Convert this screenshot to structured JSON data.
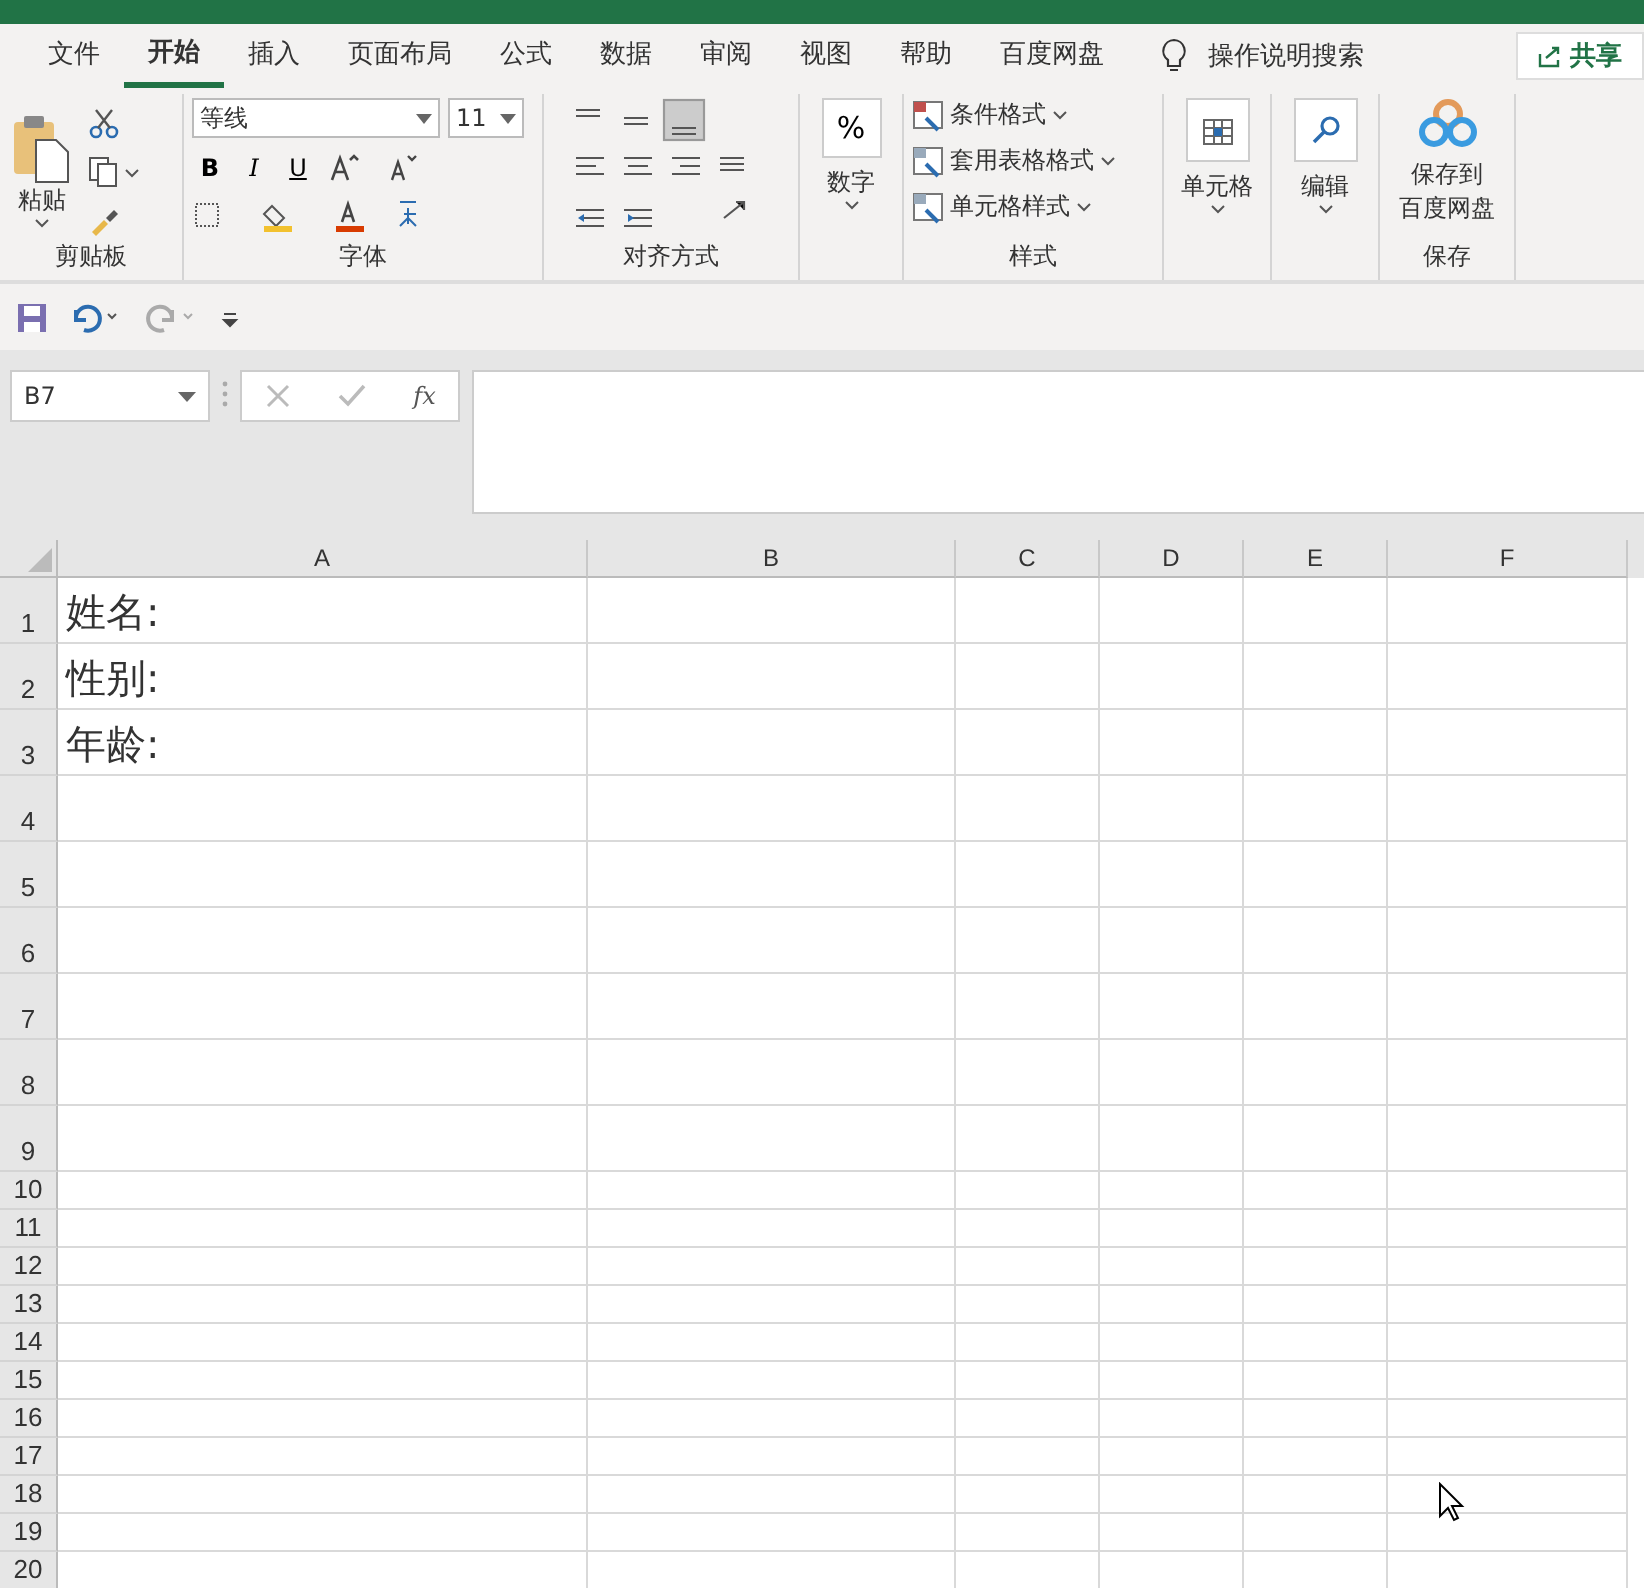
{
  "tabs": [
    {
      "label": "文件",
      "selected": false
    },
    {
      "label": "开始",
      "selected": true
    },
    {
      "label": "插入",
      "selected": false
    },
    {
      "label": "页面布局",
      "selected": false
    },
    {
      "label": "公式",
      "selected": false
    },
    {
      "label": "数据",
      "selected": false
    },
    {
      "label": "审阅",
      "selected": false
    },
    {
      "label": "视图",
      "selected": false
    },
    {
      "label": "帮助",
      "selected": false
    },
    {
      "label": "百度网盘",
      "selected": false
    }
  ],
  "tell_me": "操作说明搜索",
  "share_button": "共享",
  "ribbon": {
    "clipboard": {
      "paste": "粘贴",
      "label": "剪贴板"
    },
    "font": {
      "font_name": "等线",
      "font_size": "11",
      "format_buttons": [
        "B",
        "I",
        "U"
      ],
      "label": "字体"
    },
    "alignment": {
      "label": "对齐方式"
    },
    "number": {
      "symbol": "%",
      "button": "数字"
    },
    "styles": {
      "items": [
        "条件格式",
        "套用表格格式",
        "单元格样式"
      ],
      "label": "样式"
    },
    "cells": {
      "button": "单元格"
    },
    "editing": {
      "button": "编辑"
    },
    "save": {
      "button_lines": [
        "保存到",
        "百度网盘"
      ],
      "label": "保存"
    }
  },
  "name_box": "B7",
  "fx": "fx",
  "columns": [
    "A",
    "B",
    "C",
    "D",
    "E",
    "F"
  ],
  "rows": [
    {
      "header": "1",
      "cells": [
        "姓名:"
      ]
    },
    {
      "header": "2",
      "cells": [
        "性别:"
      ]
    },
    {
      "header": "3",
      "cells": [
        "年龄:"
      ]
    },
    {
      "header": "4",
      "cells": []
    },
    {
      "header": "5",
      "cells": []
    },
    {
      "header": "6",
      "cells": []
    },
    {
      "header": "7",
      "cells": []
    },
    {
      "header": "8",
      "cells": []
    },
    {
      "header": "9",
      "cells": []
    },
    {
      "header": "10",
      "cells": []
    },
    {
      "header": "11",
      "cells": []
    },
    {
      "header": "12",
      "cells": []
    },
    {
      "header": "13",
      "cells": []
    },
    {
      "header": "14",
      "cells": []
    },
    {
      "header": "15",
      "cells": []
    },
    {
      "header": "16",
      "cells": []
    },
    {
      "header": "17",
      "cells": []
    },
    {
      "header": "18",
      "cells": []
    },
    {
      "header": "19",
      "cells": []
    },
    {
      "header": "20",
      "cells": []
    }
  ]
}
